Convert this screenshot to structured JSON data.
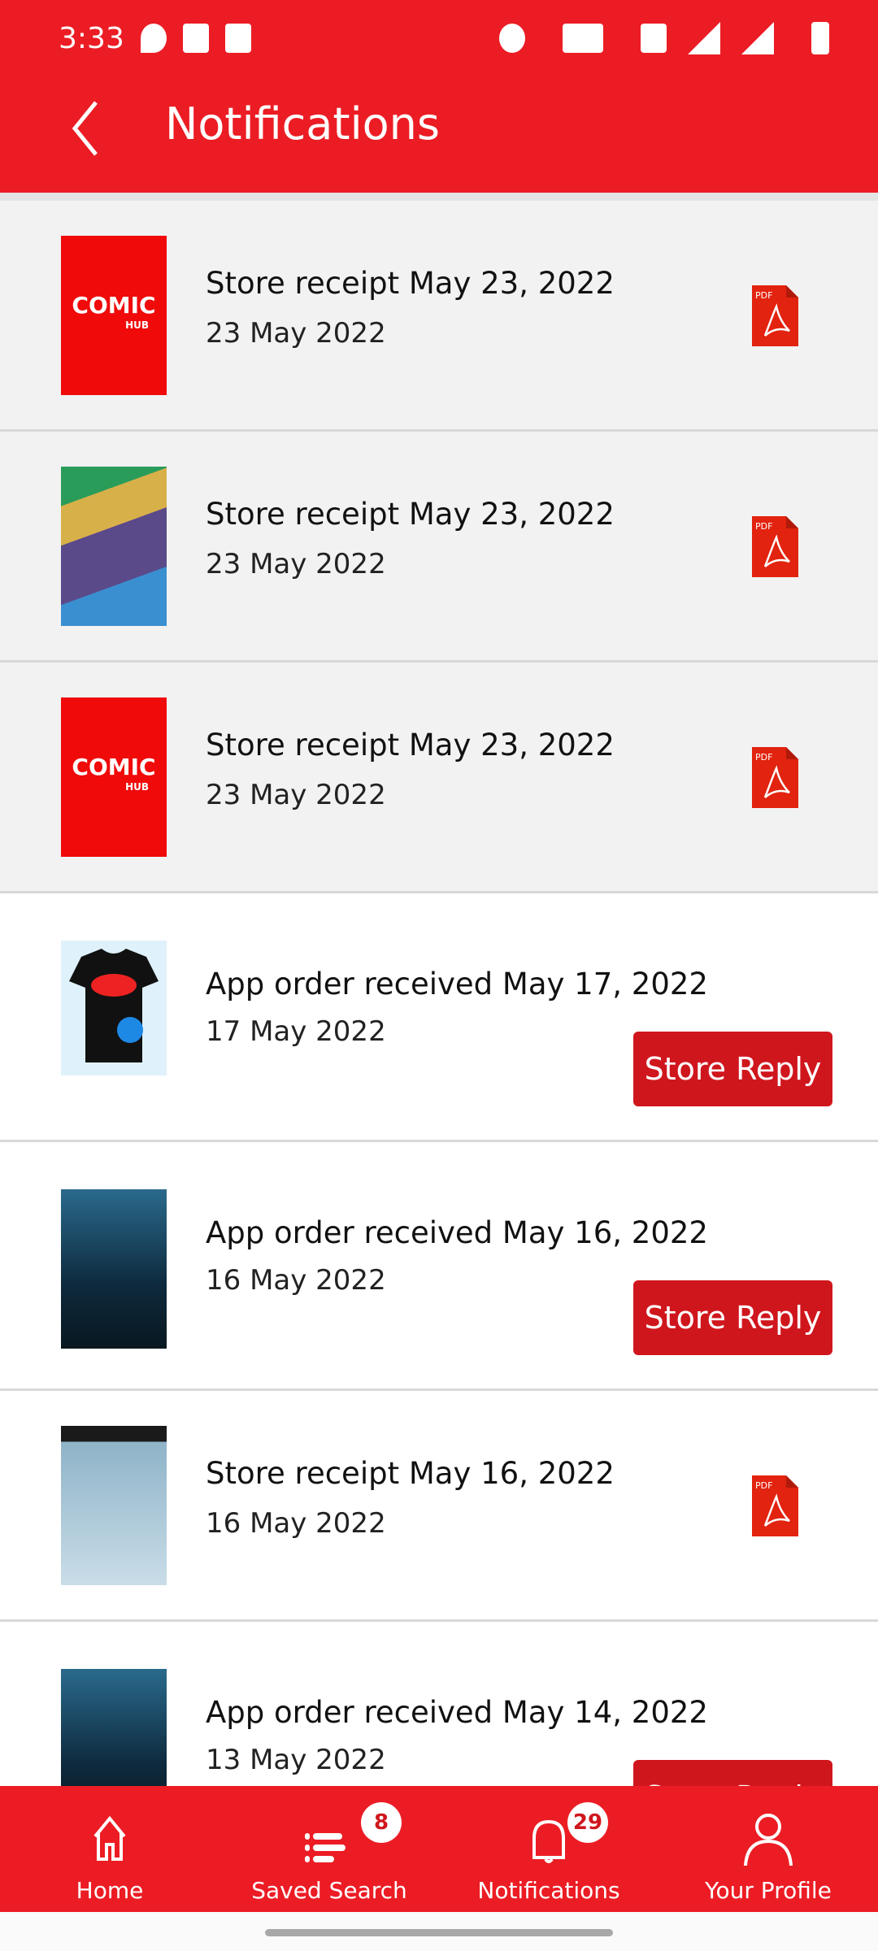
{
  "status_bar": {
    "time": "3:33"
  },
  "header": {
    "title": "Notifications"
  },
  "notifications": [
    {
      "title": "Store receipt May 23, 2022",
      "date": "23 May 2022",
      "thumb": "comic-hub-logo",
      "action": "pdf"
    },
    {
      "title": "Store receipt May 23, 2022",
      "date": "23 May 2022",
      "thumb": "robin-cover",
      "action": "pdf"
    },
    {
      "title": "Store receipt May 23, 2022",
      "date": "23 May 2022",
      "thumb": "comic-hub-logo",
      "action": "pdf"
    },
    {
      "title": "App order received May 17, 2022",
      "date": "17 May 2022",
      "thumb": "tshirt",
      "action": "Store Reply"
    },
    {
      "title": "App order received May 16, 2022",
      "date": "16 May 2022",
      "thumb": "batman-cover",
      "action": "Store Reply"
    },
    {
      "title": "Store receipt May 16, 2022",
      "date": "16 May 2022",
      "thumb": "30-days-of-night-cover",
      "action": "pdf"
    },
    {
      "title": "App order received May 14, 2022",
      "date": "13 May 2022",
      "thumb": "batman-cover",
      "action": "Store Reply"
    }
  ],
  "logo": {
    "line1": "COMIC",
    "line2": "HUB"
  },
  "pdf_label": "PDF",
  "bottom_nav": [
    {
      "label": "Home",
      "icon": "home-icon"
    },
    {
      "label": "Saved Search",
      "icon": "list-icon",
      "badge": "8"
    },
    {
      "label": "Notifications",
      "icon": "bell-icon",
      "badge": "29"
    },
    {
      "label": "Your Profile",
      "icon": "person-icon"
    }
  ],
  "colors": {
    "primary": "#ec1c24",
    "button": "#d0161d",
    "row_gray": "#f2f2f2"
  }
}
